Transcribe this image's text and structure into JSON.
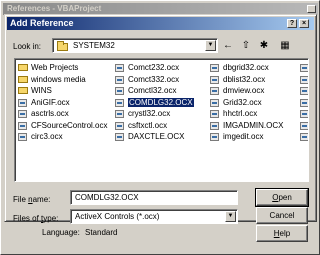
{
  "outer_window": {
    "title": "References - VBAProject",
    "status": {
      "language_label": "Language:",
      "language_value": "Standard"
    }
  },
  "dialog": {
    "title": "Add Reference",
    "help_glyph": "?",
    "close_glyph": "×",
    "look_in": {
      "label": "Look in:",
      "value": "SYSTEM32"
    },
    "toolbar": [
      {
        "name": "back-icon",
        "glyph": "←"
      },
      {
        "name": "up-folder-icon",
        "glyph": "⇧"
      },
      {
        "name": "new-folder-icon",
        "glyph": "✱"
      },
      {
        "name": "view-menu-icon",
        "glyph": "▦"
      }
    ],
    "file_columns": [
      [
        {
          "label": "Web Projects",
          "type": "folder"
        },
        {
          "label": "windows media",
          "type": "folder"
        },
        {
          "label": "WINS",
          "type": "folder"
        },
        {
          "label": "AniGIF.ocx",
          "type": "file"
        },
        {
          "label": "asctrls.ocx",
          "type": "file"
        },
        {
          "label": "CFSourceControl.ocx",
          "type": "file"
        },
        {
          "label": "circ3.ocx",
          "type": "file"
        }
      ],
      [
        {
          "label": "Comct232.ocx",
          "type": "file"
        },
        {
          "label": "Comct332.ocx",
          "type": "file"
        },
        {
          "label": "Comctl32.ocx",
          "type": "file"
        },
        {
          "label": "COMDLG32.OCX",
          "type": "file",
          "selected": true
        },
        {
          "label": "crystl32.ocx",
          "type": "file"
        },
        {
          "label": "csftxctl.ocx",
          "type": "file"
        },
        {
          "label": "DAXCTLE.OCX",
          "type": "file"
        }
      ],
      [
        {
          "label": "dbgrid32.ocx",
          "type": "file"
        },
        {
          "label": "dblist32.ocx",
          "type": "file"
        },
        {
          "label": "dmview.ocx",
          "type": "file"
        },
        {
          "label": "Grid32.ocx",
          "type": "file"
        },
        {
          "label": "hhctrl.ocx",
          "type": "file"
        },
        {
          "label": "IMGADMIN.OCX",
          "type": "file"
        },
        {
          "label": "imgedit.ocx",
          "type": "file"
        }
      ],
      [
        {
          "label": "",
          "type": "file"
        },
        {
          "label": "",
          "type": "file"
        },
        {
          "label": "",
          "type": "file"
        },
        {
          "label": "",
          "type": "file"
        },
        {
          "label": "",
          "type": "file"
        },
        {
          "label": "",
          "type": "file"
        },
        {
          "label": "",
          "type": "file"
        }
      ]
    ],
    "file_name": {
      "label_prefix": "File ",
      "label_mnemonic": "n",
      "label_suffix": "ame:",
      "value": "COMDLG32.OCX"
    },
    "file_type": {
      "label_prefix": "Files of ",
      "label_mnemonic": "t",
      "label_suffix": "ype:",
      "value": "ActiveX Controls (*.ocx)"
    },
    "buttons": {
      "open_mnemonic": "O",
      "open_rest": "pen",
      "cancel": "Cancel",
      "help_mnemonic": "H",
      "help_rest": "elp"
    }
  }
}
